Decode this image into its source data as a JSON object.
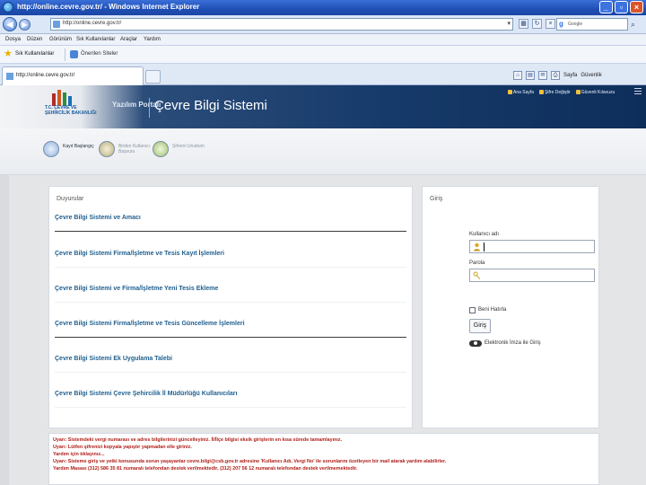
{
  "browser": {
    "title": "http://online.cevre.gov.tr/ - Windows Internet Explorer",
    "address": "http://online.cevre.gov.tr/",
    "search_placeholder": "Google",
    "menu": [
      "Dosya",
      "Düzen",
      "Görünüm",
      "Sık Kullanılanlar",
      "Araçlar",
      "Yardım"
    ],
    "favorites_label": "Sık Kullanılanlar",
    "suggested_sites": "Önerilen Siteler",
    "tab_title": "http://online.cevre.gov.tr/",
    "command_labels": [
      "Sayfa",
      "Güvenlik"
    ]
  },
  "site": {
    "ministry": "T.C. ÇEVRE VE ŞEHİRCİLİK BAKANLIĞI",
    "tagline": "Yazılım Portalı",
    "title": "Çevre Bilgi Sistemi",
    "top_links": [
      "Ana Sayfa",
      "Şifre Değiştir",
      "Güvenli Kılavuzu"
    ]
  },
  "actions": [
    {
      "label": "Kayıt Başlangıç"
    },
    {
      "label": "Birden Kullanıcı Başvuru"
    },
    {
      "label": "Şifremi Unuttum"
    }
  ],
  "announcements": {
    "title": "Duyurular",
    "items": [
      "Çevre Bilgi Sistemi ve Amacı",
      "Çevre Bilgi Sistemi Firma/İşletme ve Tesis Kayıt İşlemleri",
      "Çevre Bilgi Sistemi ve Firma/İşletme Yeni Tesis Ekleme",
      "Çevre Bilgi Sistemi Firma/İşletme ve Tesis Güncelleme İşlemleri",
      "Çevre Bilgi Sistemi Ek Uygulama Talebi",
      "Çevre Bilgi Sistemi Çevre Şehircilik İl Müdürlüğü Kullanıcıları"
    ]
  },
  "login": {
    "title": "Giriş",
    "username_label": "Kullanıcı adı",
    "password_label": "Parola",
    "remember_label": "Beni Hatırla",
    "submit_label": "Giriş",
    "esign_label": "Elektronik İmza ile Giriş"
  },
  "notice": [
    "Uyarı: Sistemdeki vergi numarası ve adres bilgilerinizi güncelleyiniz. İl/İlçe bilgisi eksik girişlerin en kısa sürede tamamlayınız.",
    "Uyarı: Lütfen şifrenizi kopyala yapıştır yapmadan elle giriniz.",
    "Yardım için tıklayınız...",
    "Uyarı: Sisteme giriş ve yetki konusunda sorun yaşayanlar cevre.bilgi@csb.gov.tr adresine 'Kullanıcı Adı, Vergi No' ile sorunlarını özetleyen bir mail atarak yardım alabilirler.",
    "Yardım Masası (312) 586 35 81 numaralı telefondan destek verilmektedir, (312) 207 56 12 numaralı telefondan destek verilmemektedir."
  ]
}
